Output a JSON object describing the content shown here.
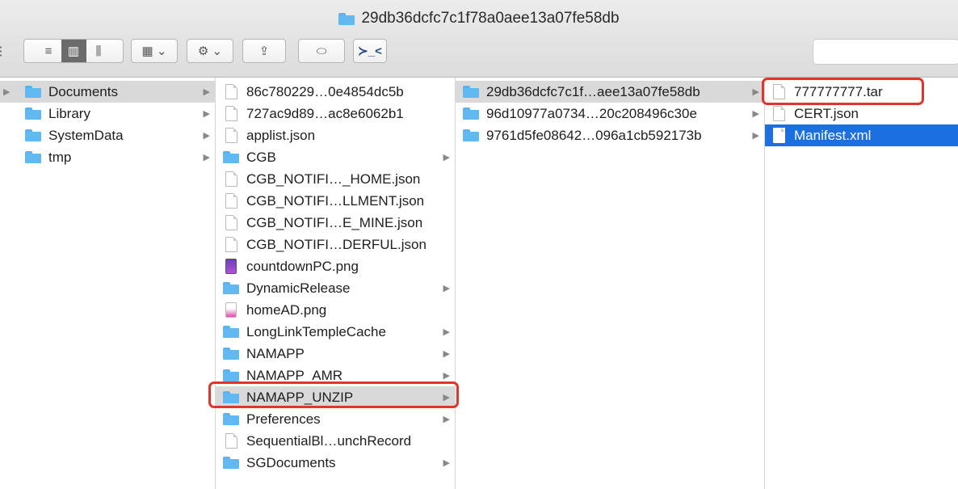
{
  "window": {
    "title": "29db36dcfc7c1f78a0aee13a07fe58db"
  },
  "toolbar": {
    "view_icon": "⋮",
    "list_icon": "≡",
    "column_icon": "▥",
    "coverflow_icon": "⫼",
    "arrange_icon": "▦ ⌄",
    "action_icon": "⚙ ⌄",
    "share_icon": "⇪",
    "tag_icon": "⬭",
    "terminal_icon": "≻_<"
  },
  "column1": [
    {
      "name": "Documents",
      "type": "folder",
      "arrow": "▶",
      "selected": "gray"
    },
    {
      "name": "Library",
      "type": "folder",
      "arrow": "▶"
    },
    {
      "name": "SystemData",
      "type": "folder",
      "arrow": "▶"
    },
    {
      "name": "tmp",
      "type": "folder",
      "arrow": "▶"
    }
  ],
  "column2": [
    {
      "name": "86c780229…0e4854dc5b",
      "type": "file"
    },
    {
      "name": "727ac9d89…ac8e6062b1",
      "type": "file"
    },
    {
      "name": "applist.json",
      "type": "file"
    },
    {
      "name": "CGB",
      "type": "folder",
      "arrow": "▶"
    },
    {
      "name": "CGB_NOTIFI…_HOME.json",
      "type": "file"
    },
    {
      "name": "CGB_NOTIFI…LLMENT.json",
      "type": "file"
    },
    {
      "name": "CGB_NOTIFI…E_MINE.json",
      "type": "file"
    },
    {
      "name": "CGB_NOTIFI…DERFUL.json",
      "type": "file"
    },
    {
      "name": "countdownPC.png",
      "type": "image"
    },
    {
      "name": "DynamicRelease",
      "type": "folder",
      "arrow": "▶"
    },
    {
      "name": "homeAD.png",
      "type": "image-light"
    },
    {
      "name": "LongLinkTempleCache",
      "type": "folder",
      "arrow": "▶"
    },
    {
      "name": "NAMAPP",
      "type": "folder",
      "arrow": "▶"
    },
    {
      "name": "NAMAPP_AMR",
      "type": "folder",
      "arrow": "▶"
    },
    {
      "name": "NAMAPP_UNZIP",
      "type": "folder",
      "arrow": "▶",
      "selected": "gray"
    },
    {
      "name": "Preferences",
      "type": "folder",
      "arrow": "▶"
    },
    {
      "name": "SequentialBl…unchRecord",
      "type": "file"
    },
    {
      "name": "SGDocuments",
      "type": "folder",
      "arrow": "▶"
    }
  ],
  "column3": [
    {
      "name": "29db36dcfc7c1f…aee13a07fe58db",
      "type": "folder",
      "arrow": "▶",
      "selected": "gray"
    },
    {
      "name": "96d10977a0734…20c208496c30e",
      "type": "folder",
      "arrow": "▶"
    },
    {
      "name": "9761d5fe08642…096a1cb592173b",
      "type": "folder",
      "arrow": "▶"
    }
  ],
  "column4": [
    {
      "name": "777777777.tar",
      "type": "file"
    },
    {
      "name": "CERT.json",
      "type": "file"
    },
    {
      "name": "Manifest.xml",
      "type": "file",
      "selected": "blue"
    }
  ],
  "colors": {
    "selection_blue": "#1b6fe0",
    "highlight_red": "#e0342c",
    "folder_blue": "#62b9f2"
  }
}
